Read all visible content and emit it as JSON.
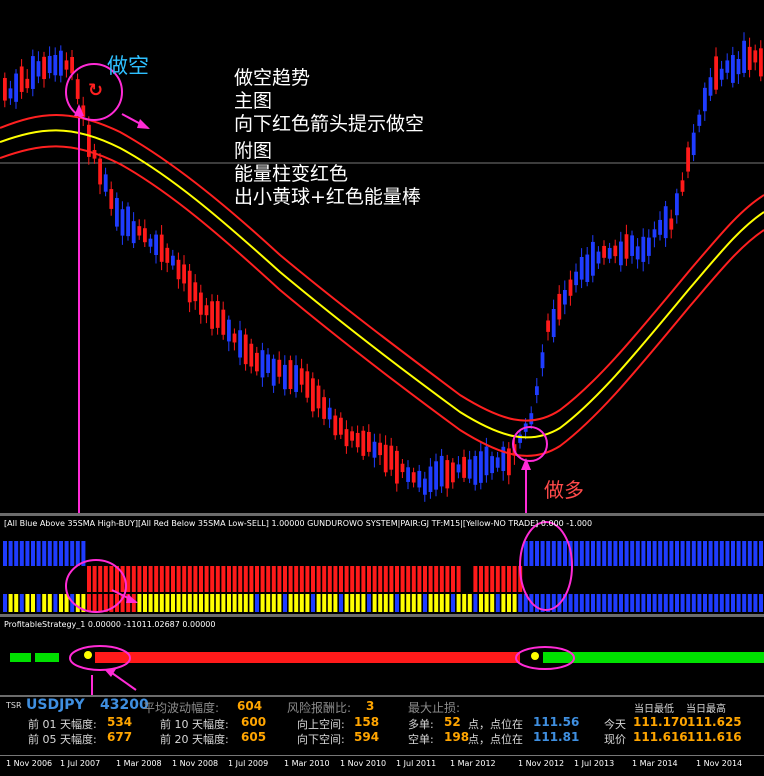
{
  "main_chart": {
    "annotation_short": "做空",
    "annotation_long": "做多",
    "note_lines": [
      "做空趋势",
      "主图",
      "向下红色箭头提示做空",
      "附图",
      "能量柱变红色",
      "出小黄球+红色能量棒"
    ]
  },
  "indicator1": {
    "title": "[All Blue Above 35SMA High-BUY][All Red Below 35SMA Low-SELL] 1.00000  GUNDUROWO SYSTEM|PAIR:GJ TF:M15|[Yellow-NO TRADE] 0.000 -1.000"
  },
  "indicator2": {
    "title": "ProfitableStrategy_1 0.00000 -11011.02687 0.00000"
  },
  "info_panel": {
    "tsr": "TSR",
    "symbol": "USDJPY",
    "value": "43200",
    "avg_volatility_label": "平均波动幅度:",
    "avg_volatility_value": "604",
    "risk_reward_label": "风险报酬比:",
    "risk_reward_value": "3",
    "max_stop_label": "最大止损:",
    "prev01_label": "前 01 天幅度:",
    "prev01_value": "534",
    "prev05_label": "前 05 天幅度:",
    "prev05_value": "677",
    "prev10_label": "前 10 天幅度:",
    "prev10_value": "600",
    "prev20_label": "前 20 天幅度:",
    "prev20_value": "605",
    "up_space_label": "向上空间:",
    "up_space_value": "158",
    "down_space_label": "向下空间:",
    "down_space_value": "594",
    "long_label": "多单:",
    "long_points": "52",
    "long_at": "点，点位在",
    "long_price": "111.56",
    "short_label": "空单:",
    "short_points": "198",
    "short_at": "点，点位在",
    "short_price": "111.81",
    "today_low_label": "当日最低",
    "today_high_label": "当日最高",
    "today_label": "今天",
    "today_low": "111.170",
    "today_high": "111.625",
    "current_label": "现价",
    "current_low": "111.616",
    "current_high": "111.616"
  },
  "x_axis_labels": [
    "1 Nov 2006",
    "1 Jul 2007",
    "1 Mar 2008",
    "1 Nov 2008",
    "1 Jul 2009",
    "1 Mar 2010",
    "1 Nov 2010",
    "1 Jul 2011",
    "1 Mar 2012",
    "1 Nov 2012",
    "1 Jul 2013",
    "1 Mar 2014",
    "1 Nov 2014"
  ],
  "colors": {
    "bull": "#1f3cff",
    "bear": "#ff1a1a",
    "yellow": "#ffff00",
    "green": "#00e000",
    "magenta": "#ff2bd6",
    "cyan": "#2ec0ff"
  }
}
